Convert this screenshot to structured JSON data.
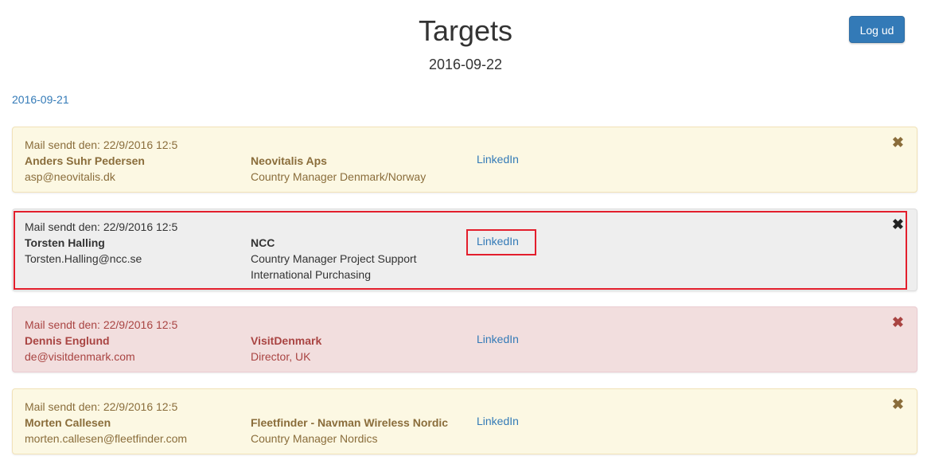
{
  "page": {
    "title": "Targets",
    "date": "2016-09-22",
    "previous_date_link": "2016-09-21",
    "logout_label": "Log ud"
  },
  "colors": {
    "primary": "#337ab7",
    "warning_bg": "#fcf8e3",
    "default_bg": "#eeeeee",
    "danger_bg": "#f2dede",
    "highlight": "#e31e2c"
  },
  "targets": [
    {
      "status": "warning",
      "sent": "Mail sendt den: 22/9/2016 12:5",
      "name": "Anders Suhr Pedersen",
      "email": "asp@neovitalis.dk",
      "company": "Neovitalis Aps",
      "title_line1": "Country Manager Denmark/Norway",
      "title_line2": "",
      "link_label": "LinkedIn",
      "close_icon": "✖"
    },
    {
      "status": "default",
      "sent": "Mail sendt den: 22/9/2016 12:5",
      "name": "Torsten Halling",
      "email": "Torsten.Halling@ncc.se",
      "company": "NCC",
      "title_line1": "Country Manager Project Support",
      "title_line2": "International Purchasing",
      "link_label": "LinkedIn",
      "close_icon": "✖"
    },
    {
      "status": "danger",
      "sent": "Mail sendt den: 22/9/2016 12:5",
      "name": "Dennis Englund",
      "email": "de@visitdenmark.com",
      "company": "VisitDenmark",
      "title_line1": "Director, UK",
      "title_line2": "",
      "link_label": "LinkedIn",
      "close_icon": "✖"
    },
    {
      "status": "warning",
      "sent": "Mail sendt den: 22/9/2016 12:5",
      "name": "Morten Callesen",
      "email": "morten.callesen@fleetfinder.com",
      "company": "Fleetfinder - Navman Wireless Nordic",
      "title_line1": "Country Manager Nordics",
      "title_line2": "",
      "link_label": "LinkedIn",
      "close_icon": "✖"
    }
  ]
}
